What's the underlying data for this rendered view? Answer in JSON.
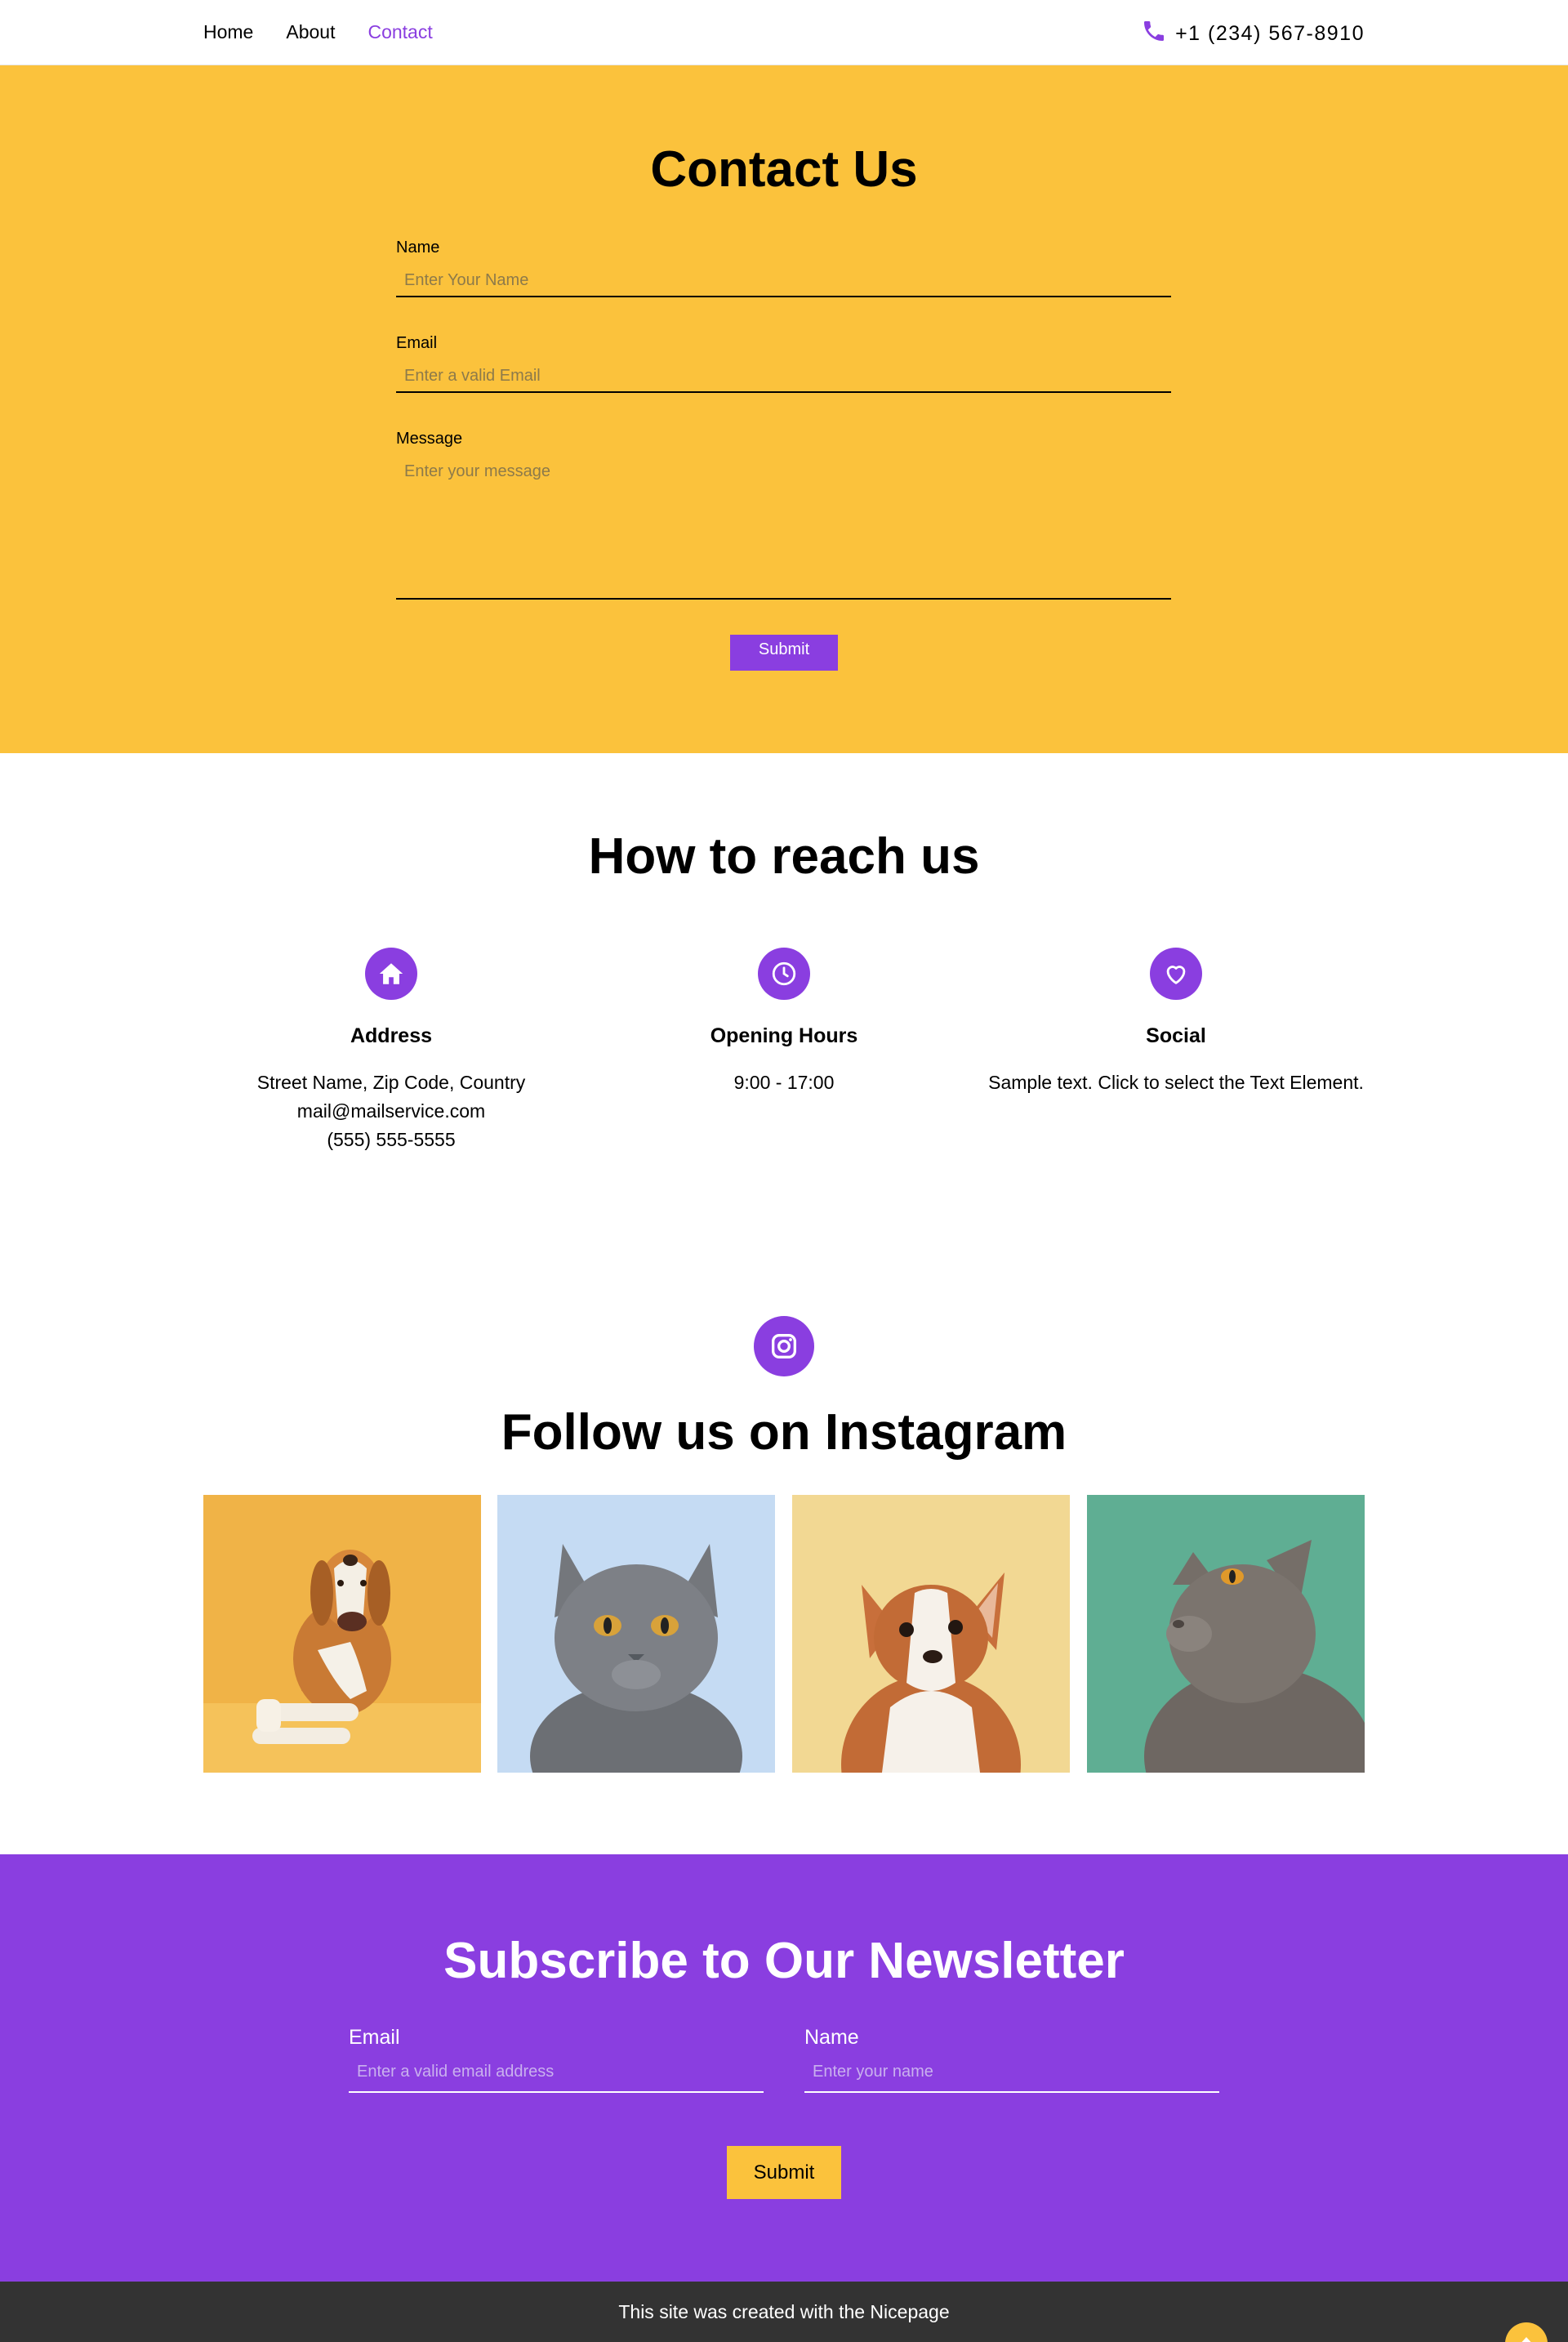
{
  "nav": {
    "items": [
      {
        "label": "Home"
      },
      {
        "label": "About"
      },
      {
        "label": "Contact"
      }
    ],
    "phone": "+1 (234) 567-8910"
  },
  "contact": {
    "title": "Contact Us",
    "name_label": "Name",
    "name_placeholder": "Enter Your Name",
    "email_label": "Email",
    "email_placeholder": "Enter a valid Email",
    "message_label": "Message",
    "message_placeholder": "Enter your message",
    "submit_label": "Submit"
  },
  "reach": {
    "title": "How to reach us",
    "columns": [
      {
        "icon": "home-icon",
        "heading": "Address",
        "lines": [
          "Street Name, Zip Code, Country",
          "mail@mailservice.com",
          "(555) 555-5555"
        ]
      },
      {
        "icon": "clock-icon",
        "heading": "Opening Hours",
        "lines": [
          "9:00 - 17:00"
        ]
      },
      {
        "icon": "heart-icon",
        "heading": "Social",
        "lines": [
          "Sample text. Click to select the Text Element."
        ]
      }
    ]
  },
  "instagram": {
    "title": "Follow us on Instagram",
    "photos": [
      {
        "subject": "dog",
        "bg": "#f0b347"
      },
      {
        "subject": "cat",
        "bg": "#c5dbf3"
      },
      {
        "subject": "dog",
        "bg": "#f2d893"
      },
      {
        "subject": "cat",
        "bg": "#5fae93"
      }
    ]
  },
  "newsletter": {
    "title": "Subscribe to Our Newsletter",
    "email_label": "Email",
    "email_placeholder": "Enter a valid email address",
    "name_label": "Name",
    "name_placeholder": "Enter your name",
    "submit_label": "Submit"
  },
  "footer": {
    "text": "This site was created with the Nicepage"
  },
  "colors": {
    "accent_purple": "#8a3ee0",
    "accent_yellow": "#fbc23c",
    "footer_bg": "#333333"
  }
}
